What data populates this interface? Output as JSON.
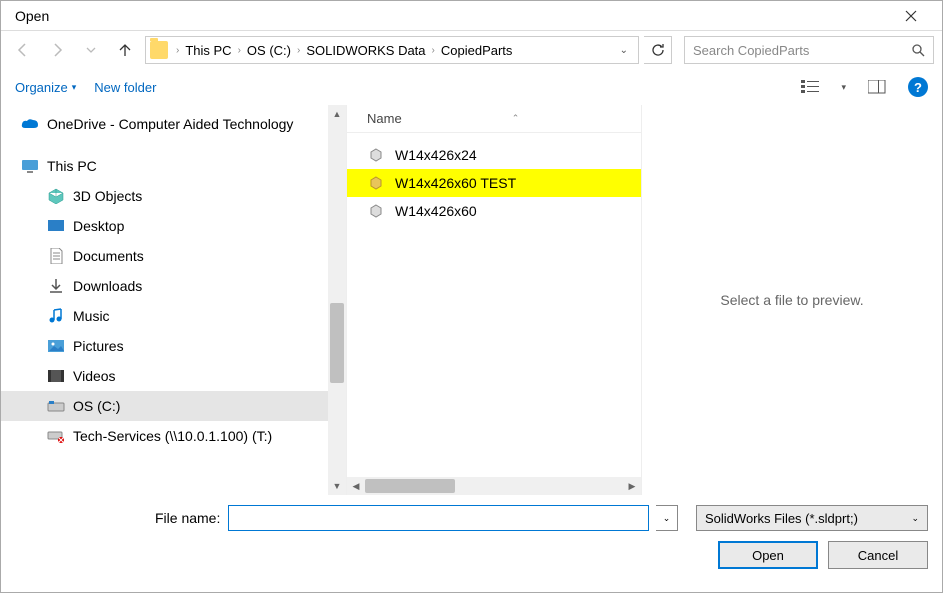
{
  "window": {
    "title": "Open"
  },
  "breadcrumbs": [
    "This PC",
    "OS (C:)",
    "SOLIDWORKS Data",
    "CopiedParts"
  ],
  "search": {
    "placeholder": "Search CopiedParts"
  },
  "toolbar": {
    "organize": "Organize",
    "new_folder": "New folder"
  },
  "sidebar": {
    "items": [
      {
        "label": "OneDrive - Computer Aided Technology",
        "icon": "onedrive"
      },
      {
        "label": "This PC",
        "icon": "pc"
      },
      {
        "label": "3D Objects",
        "icon": "3d",
        "child": true
      },
      {
        "label": "Desktop",
        "icon": "desktop",
        "child": true
      },
      {
        "label": "Documents",
        "icon": "doc",
        "child": true
      },
      {
        "label": "Downloads",
        "icon": "dl",
        "child": true
      },
      {
        "label": "Music",
        "icon": "music",
        "child": true
      },
      {
        "label": "Pictures",
        "icon": "pic",
        "child": true
      },
      {
        "label": "Videos",
        "icon": "vid",
        "child": true
      },
      {
        "label": "OS (C:)",
        "icon": "drive",
        "child": true,
        "selected": true
      },
      {
        "label": "Tech-Services (\\\\10.0.1.100) (T:)",
        "icon": "net",
        "child": true
      }
    ]
  },
  "list": {
    "col_name": "Name",
    "files": [
      {
        "name": "W14x426x24",
        "highlighted": false
      },
      {
        "name": "W14x426x60 TEST",
        "highlighted": true
      },
      {
        "name": "W14x426x60",
        "highlighted": false
      }
    ]
  },
  "preview": {
    "empty_text": "Select a file to preview."
  },
  "footer": {
    "filename_label": "File name:",
    "filename_value": "",
    "filetype": "SolidWorks Files (*.sldprt;)",
    "open": "Open",
    "cancel": "Cancel"
  }
}
